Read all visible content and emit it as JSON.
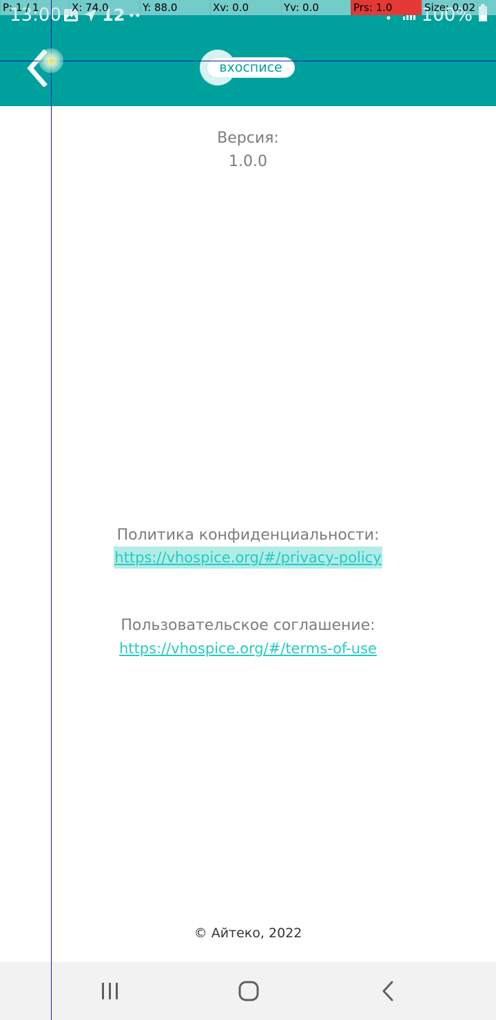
{
  "status_bar": {
    "time": "13:00",
    "network_label": "12",
    "battery_text": "100%",
    "icons": [
      "image-icon",
      "navigation-arrow-icon",
      "network-12-icon",
      "dots-icon",
      "wifi-icon",
      "signal-icon",
      "battery-icon"
    ]
  },
  "debug_overlay": {
    "pointer": "P: 1 / 1",
    "x": "X: 74.0",
    "y": "Y: 88.0",
    "xv": "Xv: 0.0",
    "yv": "Yv: 0.0",
    "prs": "Prs: 1.0",
    "size": "Size: 0.02",
    "highlight_color": "#e53935"
  },
  "app_bar": {
    "background_color": "#00a19d",
    "back_icon": "chevron-left-icon",
    "logo_text": "вхосписе"
  },
  "content": {
    "version_label": "Версия:",
    "version_value": "1.0.0",
    "privacy_label": "Политика конфиденциальности:",
    "privacy_link": "https://vhospice.org/#/privacy-policy",
    "terms_label": "Пользовательское соглашение:",
    "terms_link": "https://vhospice.org/#/terms-of-use",
    "copyright": "© Айтеко, 2022",
    "link_color": "#22cbc2"
  },
  "nav_bar": {
    "buttons": [
      "recent-apps-icon",
      "home-icon",
      "back-icon"
    ]
  }
}
